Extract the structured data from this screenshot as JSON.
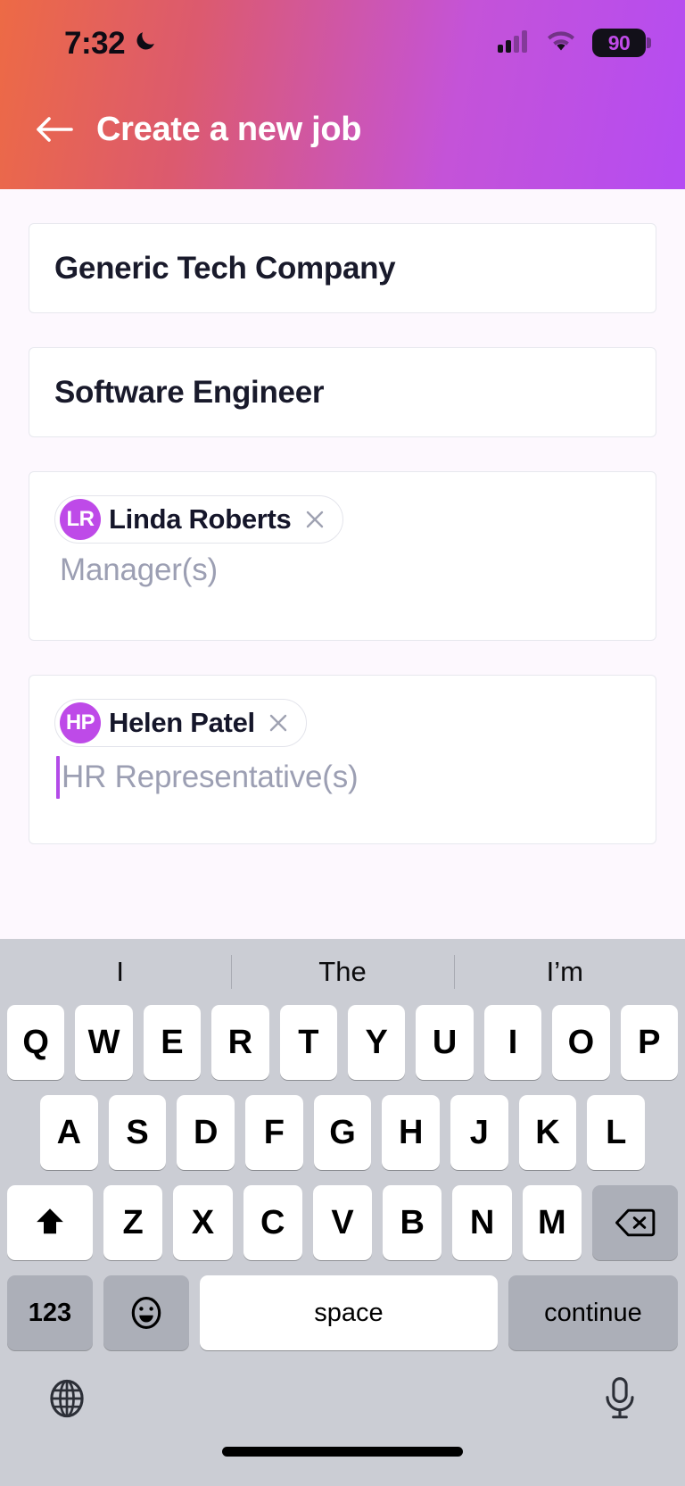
{
  "status_bar": {
    "time": "7:32",
    "moon_icon": "moon-icon",
    "cellular_icon": "cellular-signal-icon",
    "wifi_icon": "wifi-icon",
    "battery_level": "90"
  },
  "header": {
    "back_icon": "back-arrow-icon",
    "title": "Create a new job",
    "gradient_start": "#ED6A45",
    "gradient_end": "#B54CF2"
  },
  "form": {
    "company": {
      "value": "Generic Tech Company"
    },
    "role": {
      "value": "Software Engineer"
    },
    "managers": {
      "placeholder": "Manager(s)",
      "chips": [
        {
          "initials": "LR",
          "name": "Linda Roberts",
          "remove_icon": "close-icon",
          "avatar_color": "#BE4AE8"
        }
      ]
    },
    "hr_representatives": {
      "placeholder": "HR Representative(s)",
      "focused": true,
      "caret_color": "#B34BE8",
      "chips": [
        {
          "initials": "HP",
          "name": "Helen Patel",
          "remove_icon": "close-icon",
          "avatar_color": "#BE4AE8"
        }
      ]
    }
  },
  "keyboard": {
    "suggestions": [
      "I",
      "The",
      "I’m"
    ],
    "row1": [
      "Q",
      "W",
      "E",
      "R",
      "T",
      "Y",
      "U",
      "I",
      "O",
      "P"
    ],
    "row2": [
      "A",
      "S",
      "D",
      "F",
      "G",
      "H",
      "J",
      "K",
      "L"
    ],
    "row3": [
      "Z",
      "X",
      "C",
      "V",
      "B",
      "N",
      "M"
    ],
    "shift_icon": "shift-icon",
    "backspace_icon": "backspace-icon",
    "numbers_label": "123",
    "emoji_icon": "emoji-icon",
    "space_label": "space",
    "return_label": "continue",
    "globe_icon": "globe-icon",
    "mic_icon": "microphone-icon"
  }
}
